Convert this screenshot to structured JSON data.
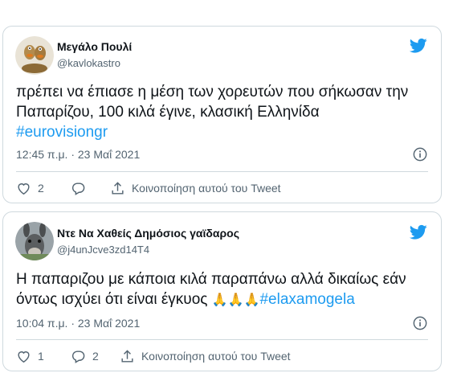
{
  "tweets": [
    {
      "author_name": "Μεγάλο Πουλί",
      "handle": "@kavlokastro",
      "text": "πρέπει να έπιασε η μέση των χορευτών που σήκωσαν την Παπαρίζου, 100 κιλά έγινε, κλασική Ελληνίδα",
      "hashtag": "#eurovisiongr",
      "timestamp": "12:45 π.μ. · 23 Μαΐ 2021",
      "likes": "2",
      "replies": "",
      "share_label": "Κοινοποίηση αυτού του Tweet",
      "avatar_icon": "cartoon-duck-avatar"
    },
    {
      "author_name": "Ντε Να Χαθείς Δημόσιος γαϊδαρος",
      "handle": "@j4unJcve3zd14T4",
      "text": "Η παπαριζου με κάποια κιλά παραπάνω αλλά δικαίως εάν όντως ισχύει ότι είναι έγκυος",
      "emoji": "🙏🙏🙏",
      "hashtag": "#elaxamogela",
      "timestamp": "10:04 π.μ. · 23 Μαΐ 2021",
      "likes": "1",
      "replies": "2",
      "share_label": "Κοινοποίηση αυτού του Tweet",
      "avatar_icon": "donkey-photo-avatar"
    }
  ],
  "colors": {
    "brand": "#1d9bf0",
    "text": "#0f1419",
    "secondary": "#536471",
    "border": "#cfd9de"
  }
}
